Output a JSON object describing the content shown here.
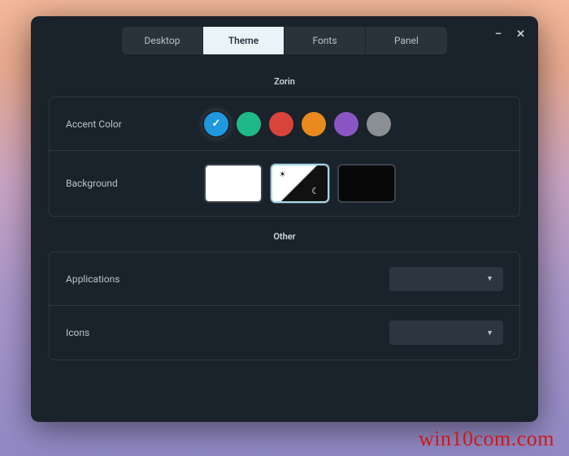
{
  "tabs": [
    {
      "label": "Desktop",
      "active": false
    },
    {
      "label": "Theme",
      "active": true
    },
    {
      "label": "Fonts",
      "active": false
    },
    {
      "label": "Panel",
      "active": false
    }
  ],
  "sections": {
    "zorin": {
      "title": "Zorin",
      "accent": {
        "label": "Accent Color",
        "colors": [
          {
            "name": "blue",
            "hex": "#1f98e0",
            "selected": true
          },
          {
            "name": "green",
            "hex": "#1fb887",
            "selected": false
          },
          {
            "name": "red",
            "hex": "#d9433a",
            "selected": false
          },
          {
            "name": "orange",
            "hex": "#e88a1e",
            "selected": false
          },
          {
            "name": "purple",
            "hex": "#8a56c2",
            "selected": false
          },
          {
            "name": "grey",
            "hex": "#8a8f93",
            "selected": false
          }
        ]
      },
      "background": {
        "label": "Background",
        "options": [
          {
            "name": "light",
            "selected": false
          },
          {
            "name": "auto",
            "selected": true
          },
          {
            "name": "dark",
            "selected": false
          }
        ]
      }
    },
    "other": {
      "title": "Other",
      "applications": {
        "label": "Applications",
        "value": ""
      },
      "icons": {
        "label": "Icons",
        "value": ""
      }
    }
  },
  "watermark": "win10com.com"
}
